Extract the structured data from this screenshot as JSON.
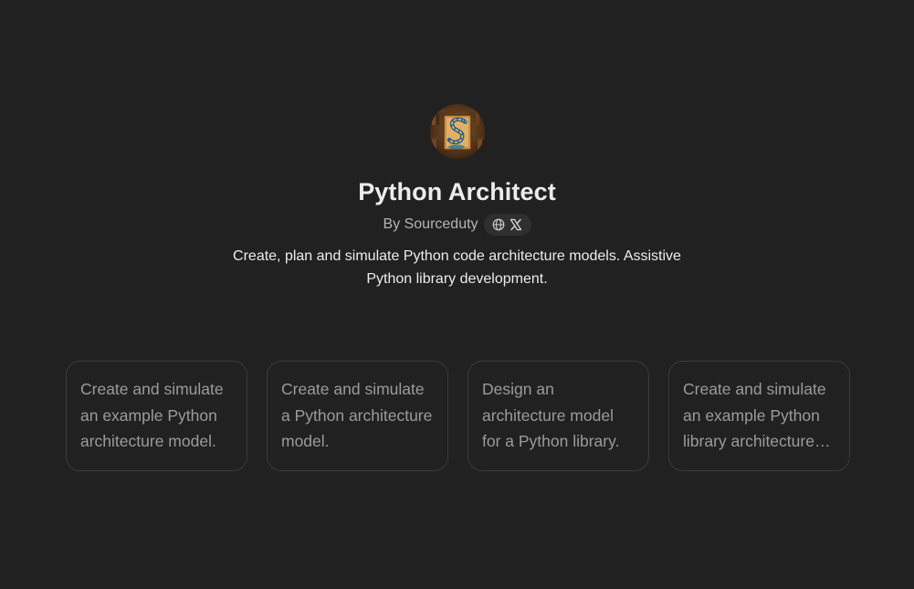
{
  "gpt": {
    "name": "Python Architect",
    "by_prefix": "By",
    "author": "Sourceduty",
    "description": "Create, plan and simulate Python code architecture models. Assistive Python library development.",
    "avatar_icon": "python-snake-book-icon",
    "social_icons": [
      "globe-icon",
      "x-logo-icon"
    ]
  },
  "starters": [
    {
      "text": "Create and simulate an example Python architecture model."
    },
    {
      "text": "Create and simulate a Python architecture model."
    },
    {
      "text": "Design an architecture model for a Python library."
    },
    {
      "text": "Create and simulate an example Python library architecture model."
    }
  ],
  "colors": {
    "background": "#212121",
    "title": "#ececec",
    "muted": "#b4b4b4",
    "card_border": "#3b3b3b",
    "card_text": "#9b9b9b",
    "pill_bg": "#2f2f2f"
  }
}
